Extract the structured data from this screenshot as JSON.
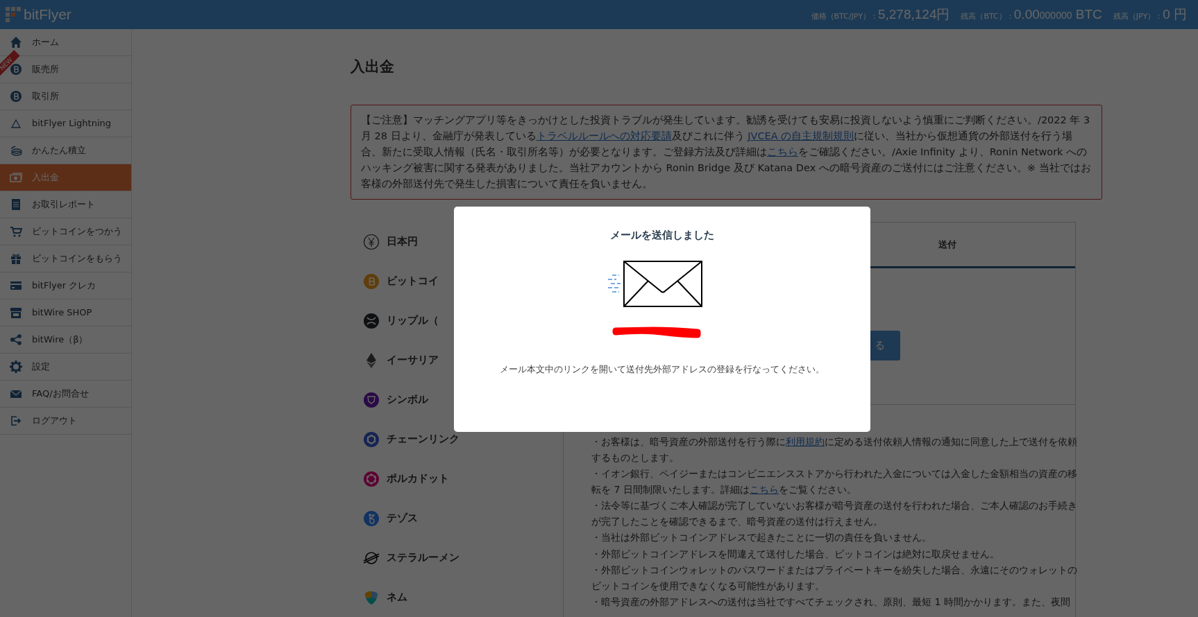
{
  "header": {
    "logo": "bitFlyer",
    "stats": [
      {
        "label": "価格（BTC/JPY）：",
        "value": "5,278,124円"
      },
      {
        "label": "残高（BTC）：",
        "value": "0.00",
        "value_minor": "000000",
        "unit": "BTC"
      },
      {
        "label": "残高（JPY）：",
        "value": "0 円"
      }
    ]
  },
  "sidebar": {
    "items": [
      {
        "label": "ホーム",
        "selected": false
      },
      {
        "label": "販売所",
        "selected": false,
        "ribbon": "NEW"
      },
      {
        "label": "取引所",
        "selected": false
      },
      {
        "label": "bitFlyer Lightning",
        "selected": false
      },
      {
        "label": "かんたん積立",
        "selected": false
      },
      {
        "label": "入出金",
        "selected": true
      },
      {
        "label": "お取引レポート",
        "selected": false
      },
      {
        "label": "ビットコインをつかう",
        "selected": false
      },
      {
        "label": "ビットコインをもらう",
        "selected": false
      },
      {
        "label": "bitFlyer クレカ",
        "selected": false
      },
      {
        "label": "bitWire SHOP",
        "selected": false
      },
      {
        "label": "bitWire（β）",
        "selected": false
      },
      {
        "label": "設定",
        "selected": false
      },
      {
        "label": "FAQ/お問合せ",
        "selected": false
      },
      {
        "label": "ログアウト",
        "selected": false
      }
    ]
  },
  "page_title": "入出金",
  "notice": {
    "segments": [
      {
        "kind": "text",
        "text": "【ご注意】マッチングアプリ等をきっかけとした投資トラブルが発生しています。勧誘を受けても安易に投資しないよう慎重にご判断ください。/2022 年 3 月 28 日より、金融庁が発表している"
      },
      {
        "kind": "link",
        "text": "トラベルルールへの対応要請"
      },
      {
        "kind": "text",
        "text": "及びこれに伴う "
      },
      {
        "kind": "link",
        "text": "JVCEA の自主規制規則"
      },
      {
        "kind": "text",
        "text": "に従い、当社から仮想通貨の外部送付を行う場合、新たに受取人情報（氏名・取引所名等）が必要となります。ご登録方法及び詳細は"
      },
      {
        "kind": "link",
        "text": "こちら"
      },
      {
        "kind": "text",
        "text": "をご確認ください。/Axie Infinity より、Ronin Network へのハッキング被害に関する発表がありました。当社アカウントから Ronin Bridge 及び Katana Dex への暗号資産のご送付にはご注意ください。※ 当社ではお客様の外部送付先で発生した損害について責任を負いません。"
      }
    ]
  },
  "currencies": [
    {
      "name": "日本円"
    },
    {
      "name": "ビットコイ"
    },
    {
      "name": "リップル（"
    },
    {
      "name": "イーサリア"
    },
    {
      "name": "シンボル"
    },
    {
      "name": "チェーンリンク"
    },
    {
      "name": "ポルカドット"
    },
    {
      "name": "テゾス"
    },
    {
      "name": "ステラルーメン"
    },
    {
      "name": "ネム"
    }
  ],
  "panel": {
    "tabs": [
      {
        "label": "送付",
        "selected": true
      }
    ],
    "button": "る",
    "bullets": [
      {
        "segments": [
          {
            "kind": "text",
            "text": "・お客様は、暗号資産の外部送付を行う際に"
          },
          {
            "kind": "link",
            "text": "利用規約"
          },
          {
            "kind": "text",
            "text": "に定める送付依頼人情報の通知に同意した上で送付を依頼するものとします。"
          }
        ]
      },
      {
        "segments": [
          {
            "kind": "text",
            "text": "・イオン銀行、ペイジーまたはコンビニエンスストアから行われた入金については入金した金額相当の資産の移転を 7 日間制限いたします。詳細は"
          },
          {
            "kind": "link",
            "text": "こちら"
          },
          {
            "kind": "text",
            "text": "をご覧ください。"
          }
        ]
      },
      {
        "segments": [
          {
            "kind": "text",
            "text": "・法令等に基づくご本人確認が完了していないお客様が暗号資産の送付を行われた場合、ご本人確認のお手続きが完了したことを確認できるまで、暗号資産の送付は行えません。"
          }
        ]
      },
      {
        "segments": [
          {
            "kind": "text",
            "text": "・当社は外部ビットコインアドレスで起きたことに一切の責任を負いません。"
          }
        ]
      },
      {
        "segments": [
          {
            "kind": "text",
            "text": "・外部ビットコインアドレスを間違えて送付した場合、ビットコインは絶対に取戻せません。"
          }
        ]
      },
      {
        "segments": [
          {
            "kind": "text",
            "text": "・外部ビットコインウォレットのパスワードまたはプライベートキーを紛失した場合、永遠にそのウォレットのビットコインを使用できなくなる可能性があります。"
          }
        ]
      },
      {
        "segments": [
          {
            "kind": "text",
            "text": "・暗号資産の外部アドレスへの送付は当社ですべてチェックされ、原則、最短 1 時間かかります。また、夜間"
          }
        ]
      }
    ]
  },
  "modal": {
    "title": "メールを送信しました",
    "message": "メール本文中のリンクを開いて送付先外部アドレスの登録を行なってください。"
  }
}
